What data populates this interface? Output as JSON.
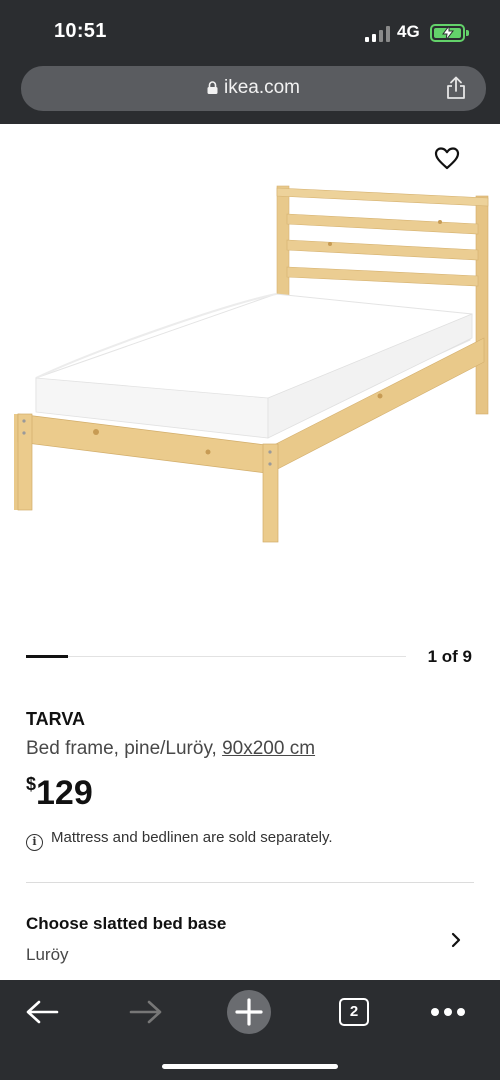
{
  "status_bar": {
    "time": "10:51",
    "network": "4G",
    "battery_color": "#63d26a"
  },
  "browser": {
    "url": "ikea.com",
    "tab_count": "2",
    "icons": [
      "lock-icon",
      "share-icon",
      "back-icon",
      "forward-icon",
      "new-tab-icon",
      "tabs-icon",
      "more-icon"
    ]
  },
  "gallery": {
    "position": "1 of 9",
    "current": 1,
    "total": 9
  },
  "product": {
    "name": "TARVA",
    "description": "Bed frame, pine/Luröy,",
    "size_link": "90x200 cm",
    "currency": "$",
    "price": "129",
    "note": "Mattress and bedlinen are sold separately."
  },
  "option": {
    "title": "Choose slatted bed base",
    "value": "Luröy"
  }
}
